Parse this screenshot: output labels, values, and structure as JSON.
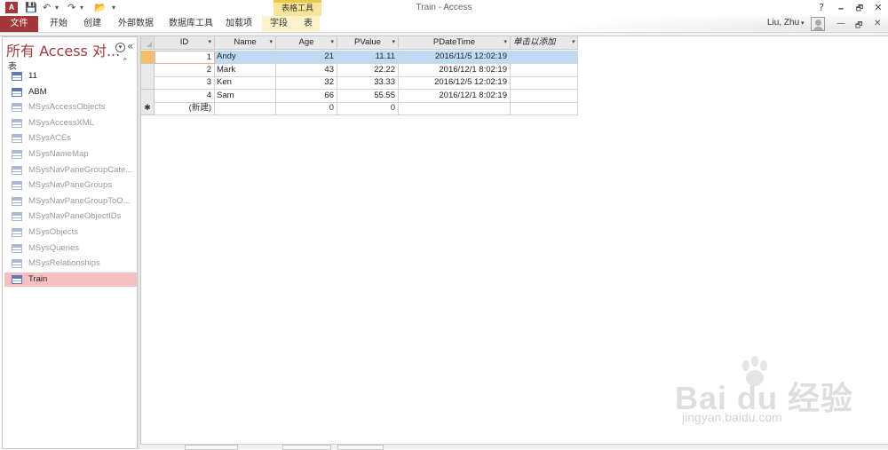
{
  "window": {
    "title": "Train - Access",
    "app_icon": "A",
    "help": "?",
    "minimize": "🗕",
    "restore": "🗗",
    "close": "✕"
  },
  "qat": {
    "save": "💾",
    "undo": "↶",
    "undo_dd": "▾",
    "redo": "↷",
    "redo_dd": "▾",
    "open": "📂",
    "customize": "▾"
  },
  "ribbon": {
    "context_title": "表格工具",
    "tabs": [
      "文件",
      "开始",
      "创建",
      "外部数据",
      "数据库工具",
      "加载项",
      "字段",
      "表"
    ],
    "user": "Liu, Zhu",
    "user_dd": "▾",
    "ctrl_min": "—",
    "ctrl_restore": "🗗",
    "ctrl_close": "✕"
  },
  "nav": {
    "title": "所有 Access 对...",
    "dropdown": "▾",
    "collapse": "«",
    "group": "表",
    "group_chev": "⌃",
    "items": [
      {
        "label": "11",
        "sys": false
      },
      {
        "label": "ABM",
        "sys": false
      },
      {
        "label": "MSysAccessObjects",
        "sys": true
      },
      {
        "label": "MSysAccessXML",
        "sys": true
      },
      {
        "label": "MSysACEs",
        "sys": true
      },
      {
        "label": "MSysNameMap",
        "sys": true
      },
      {
        "label": "MSysNavPaneGroupCate...",
        "sys": true
      },
      {
        "label": "MSysNavPaneGroups",
        "sys": true
      },
      {
        "label": "MSysNavPaneGroupToO...",
        "sys": true
      },
      {
        "label": "MSysNavPaneObjectIDs",
        "sys": true
      },
      {
        "label": "MSysObjects",
        "sys": true
      },
      {
        "label": "MSysQueries",
        "sys": true
      },
      {
        "label": "MSysRelationships",
        "sys": true
      },
      {
        "label": "Train",
        "sys": false,
        "selected": true
      }
    ]
  },
  "table": {
    "columns": [
      "ID",
      "Name",
      "Age",
      "PValue",
      "PDateTime",
      "单击以添加"
    ],
    "sort_arrow": "▾",
    "rows": [
      [
        "1",
        "Andy",
        "21",
        "11.11",
        "2016/11/5 12:02:19"
      ],
      [
        "2",
        "Mark",
        "43",
        "22.22",
        "2016/12/1 8:02:19"
      ],
      [
        "3",
        "Ken",
        "32",
        "33.33",
        "2016/12/5 12:02:19"
      ],
      [
        "4",
        "Sam",
        "66",
        "55.55",
        "2016/12/1 8:02:19"
      ]
    ],
    "new_row": [
      "(新建)",
      "",
      "0",
      "0",
      ""
    ],
    "new_marker": "✱"
  },
  "watermark": {
    "brand": "Bai du 经验",
    "url": "jingyan.baidu.com"
  },
  "colors": {
    "accent": "#a4373a",
    "selection": "#f6c0c3",
    "current_row": "#bfdaf3",
    "context_tab": "#f7e69a"
  }
}
